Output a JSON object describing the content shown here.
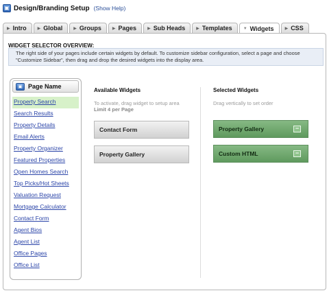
{
  "header": {
    "icon": "browser-window-icon",
    "title": "Design/Branding Setup",
    "help_link": "(Show Help)"
  },
  "tabs": [
    {
      "label": "Intro",
      "active": false
    },
    {
      "label": "Global",
      "active": false
    },
    {
      "label": "Groups",
      "active": false
    },
    {
      "label": "Pages",
      "active": false
    },
    {
      "label": "Sub Heads",
      "active": false
    },
    {
      "label": "Templates",
      "active": false
    },
    {
      "label": "Widgets",
      "active": true
    },
    {
      "label": "CSS",
      "active": false
    }
  ],
  "overview": {
    "title": "WIDGET SELECTOR OVERVIEW:",
    "text": "The right side of your pages include certain widgets by default. To customize sidebar configuration, select a page and choose \"Customize Sidebar\", then drag and drop the desired widgets into the display area."
  },
  "page_name": {
    "title": "Page Name",
    "icon": "browser-window-icon",
    "items": [
      {
        "label": "Property Search",
        "selected": true
      },
      {
        "label": "Search Results"
      },
      {
        "label": "Property Details"
      },
      {
        "label": "Email Alerts"
      },
      {
        "label": "Property Organizer"
      },
      {
        "label": "Featured Properties"
      },
      {
        "label": "Open Homes Search"
      },
      {
        "label": "Top Picks/Hot Sheets"
      },
      {
        "label": "Valuation Request"
      },
      {
        "label": "Mortgage Calculator"
      },
      {
        "label": "Contact Form"
      },
      {
        "label": "Agent Bios"
      },
      {
        "label": "Agent List"
      },
      {
        "label": "Office Pages"
      },
      {
        "label": "Office List"
      }
    ]
  },
  "available_widgets": {
    "title": "Available Widgets",
    "instruction": "To activate, drag widget to setup area",
    "limit": "Limit 4 per Page",
    "items": [
      {
        "label": "Contact Form"
      },
      {
        "label": "Property Gallery"
      }
    ]
  },
  "selected_widgets": {
    "title": "Selected Widgets",
    "instruction": "Drag vertically to set order",
    "remove_symbol": "−",
    "items": [
      {
        "label": "Property Gallery"
      },
      {
        "label": "Custom HTML"
      }
    ]
  },
  "colors": {
    "link": "#2a44a8",
    "selected_row": "#d7f1c9",
    "selected_widget": "#6fa86d",
    "overview_bg": "#e9eef6"
  }
}
